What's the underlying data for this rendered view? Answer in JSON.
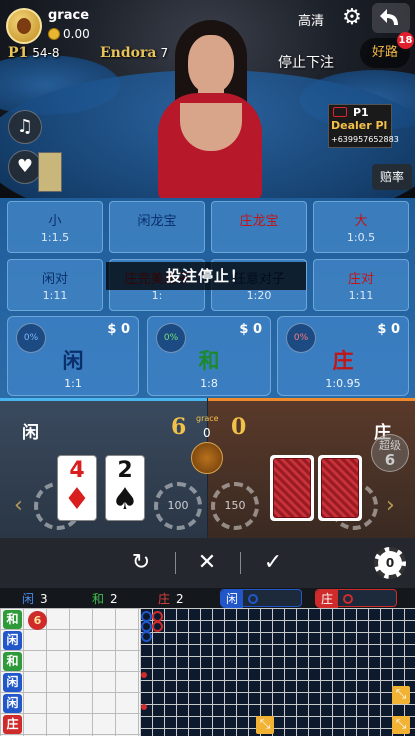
{
  "user": {
    "name": "grace",
    "balance": "0.00"
  },
  "tables_in_view": [
    {
      "tag": "P1",
      "value": "54-8"
    },
    {
      "tag": "Endora",
      "value": "7"
    }
  ],
  "header": {
    "quality_label": "高清",
    "route_label": "好路",
    "route_badge": "18",
    "bet_status": "停止下注"
  },
  "dealer_plate": {
    "seat": "P1",
    "title": "Dealer Pl",
    "phone": "+639957652883"
  },
  "side_buttons": {
    "music": "♫",
    "favorite": "♥",
    "odds_label": "赔率"
  },
  "bets_small": [
    {
      "name": "小",
      "odds": "1:1.5",
      "color": "blue"
    },
    {
      "name": "闲龙宝",
      "odds": "",
      "color": "blue"
    },
    {
      "name": "庄龙宝",
      "odds": "",
      "color": "red"
    },
    {
      "name": "大",
      "odds": "1:0.5",
      "color": "red"
    },
    {
      "name": "闲对",
      "odds": "1:11",
      "color": "blue"
    },
    {
      "name": "庄完美对子",
      "odds": "1:",
      "color": "red"
    },
    {
      "name": "任意对子",
      "odds": "1:20",
      "color": "blue"
    },
    {
      "name": "庄对",
      "odds": "1:11",
      "color": "red"
    }
  ],
  "stop_banner": "投注停止！",
  "bets_main": [
    {
      "name": "闲",
      "odds": "1:1",
      "percent": "0%",
      "amount": "0",
      "color": "blue"
    },
    {
      "name": "和",
      "odds": "1:8",
      "percent": "0%",
      "amount": "0",
      "color": "green"
    },
    {
      "name": "庄",
      "odds": "1:0.95",
      "percent": "0%",
      "amount": "0",
      "color": "red"
    }
  ],
  "result": {
    "player_label": "闲",
    "banker_label": "庄",
    "player_score": "6",
    "banker_score": "0",
    "center_name": "grace",
    "center_value": "0",
    "player_cards": [
      {
        "rank": "4",
        "suit": "♦",
        "color": "red"
      },
      {
        "rank": "2",
        "suit": "♠",
        "color": "black"
      }
    ],
    "chips": [
      "100",
      "150"
    ],
    "super6_line1": "超级",
    "super6_line2": "6"
  },
  "actions": {
    "repeat": "↻",
    "cancel": "✕",
    "confirm": "✓",
    "chip": "0"
  },
  "stats": {
    "player": {
      "label": "闲",
      "count": "3"
    },
    "tie": {
      "label": "和",
      "count": "2"
    },
    "banker": {
      "label": "庄",
      "count": "2"
    },
    "ask_player": "闲",
    "ask_banker": "庄"
  },
  "bead_road": [
    "和",
    "闲",
    "和",
    "闲",
    "闲",
    "庄"
  ],
  "bead_badge": "6",
  "colors": {
    "player": "#2157c9",
    "banker": "#cf2b2b",
    "tie": "#2f9a3a",
    "accent": "#f2c14a"
  }
}
